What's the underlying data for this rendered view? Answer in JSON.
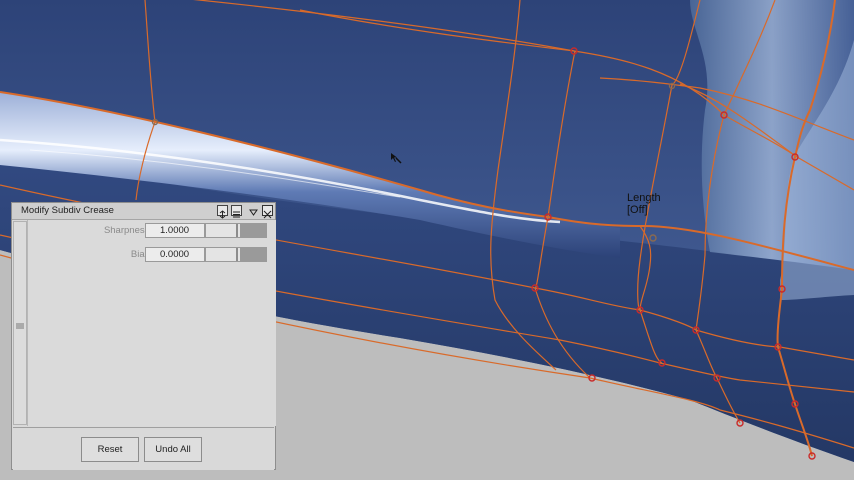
{
  "viewport": {
    "background_color": "#b9b9b9",
    "surface_color": "#3c5588",
    "mesh_color": "#d96a2a",
    "vertex_color": "#cc2a2a"
  },
  "hud": {
    "tool_name": "Length",
    "tool_state": "[Off]"
  },
  "panel": {
    "title": "Modify Subdiv Crease",
    "fields": [
      {
        "label": "Sharpness:",
        "value": "1.0000"
      },
      {
        "label": "Bias:",
        "value": "0.0000"
      }
    ],
    "buttons": {
      "reset": "Reset",
      "undo_all": "Undo All"
    },
    "icons": [
      "pin-icon",
      "menu-icon",
      "collapse-icon",
      "close-icon"
    ]
  }
}
